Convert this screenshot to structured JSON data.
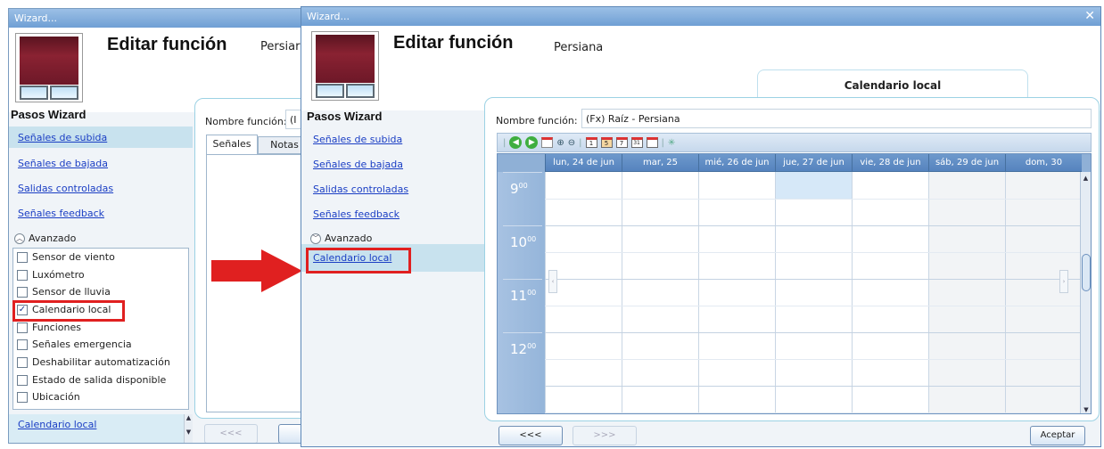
{
  "left_window": {
    "title": "Wizard...",
    "header_title": "Editar función",
    "header_sub": "Persiar",
    "steps_title": "Pasos Wizard",
    "steps": [
      "Señales de subida",
      "Señales de bajada",
      "Salidas controladas",
      "Señales feedback"
    ],
    "advanced_label": "Avanzado",
    "checkboxes": [
      {
        "label": "Sensor de viento",
        "checked": ""
      },
      {
        "label": "Luxómetro",
        "checked": ""
      },
      {
        "label": "Sensor de lluvia",
        "checked": ""
      },
      {
        "label": "Calendario local",
        "checked": "✓"
      },
      {
        "label": "Funciones",
        "checked": ""
      },
      {
        "label": "Señales emergencia",
        "checked": ""
      },
      {
        "label": "Deshabilitar automatización",
        "checked": ""
      },
      {
        "label": "Estado de salida disponible",
        "checked": ""
      },
      {
        "label": "Ubicación",
        "checked": ""
      }
    ],
    "bottom_link": "Calendario local",
    "name_label": "Nombre función:",
    "name_value": "(I",
    "tabs": [
      "Señales",
      "Notas"
    ],
    "back_button": "<<<"
  },
  "right_window": {
    "title": "Wizard...",
    "close_glyph": "✕",
    "header_title": "Editar función",
    "header_sub": "Persiana",
    "tab_label": "Calendario local",
    "steps_title": "Pasos Wizard",
    "steps": [
      "Señales de subida",
      "Señales de bajada",
      "Salidas controladas",
      "Señales feedback"
    ],
    "advanced_label": "Avanzado",
    "advanced_link": "Calendario local",
    "name_label": "Nombre función:",
    "name_value": "(Fx) Raíz - Persiana",
    "back_button": "<<<",
    "next_button": ">>>",
    "accept_button": "Aceptar"
  },
  "calendar": {
    "days": [
      "lun, 24 de jun",
      "mar, 25",
      "mié, 26 de jun",
      "jue, 27 de jun",
      "vie, 28 de jun",
      "sáb, 29 de jun",
      "dom, 30"
    ],
    "hours": [
      "9",
      "10",
      "11",
      "12"
    ],
    "minutes_sup": "00",
    "toolbar_icons": [
      "go-back-icon",
      "go-forward-icon",
      "today-icon",
      "zoom-in-icon",
      "zoom-out-icon",
      "day-view-icon",
      "work-week-view-icon",
      "week-view-icon",
      "month-view-icon",
      "timeline-view-icon",
      "export-icon"
    ],
    "highlight_color": "#d6e8f8",
    "weekend_color": "#f2f4f6"
  },
  "arrow_color": "#e02020"
}
